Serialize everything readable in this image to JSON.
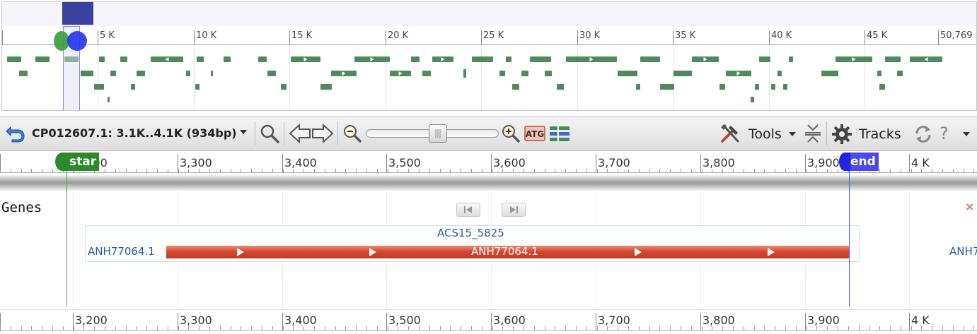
{
  "overview": {
    "labels": [
      "5 K",
      "10 K",
      "15 K",
      "20 K",
      "25 K",
      "30 K",
      "35 K",
      "40 K",
      "45 K",
      "50,769"
    ]
  },
  "toolbar": {
    "location": "CP012607.1: 3.1K..4.1K (934bp)",
    "tools_label": "Tools",
    "tracks_label": "Tracks",
    "help_label": "?"
  },
  "ruler": {
    "labels": [
      "3,200",
      "3,300",
      "3,400",
      "3,500",
      "3,600",
      "3,700",
      "3,800",
      "3,900",
      "4 K"
    ],
    "start_label": "star",
    "end_label": "end"
  },
  "track": {
    "label": "Genes",
    "close": "×",
    "gene_name": "ACS15_5825",
    "gene_left_label": "ANH77064.1",
    "gene_bar_label": "ANH77064.1",
    "gene_right_label": "ANH7"
  },
  "colors": {
    "feature_green": "#4f8a5b",
    "gene_red": "#c23a24",
    "start_green": "#2b8a2b",
    "end_blue": "#4a4af0"
  }
}
